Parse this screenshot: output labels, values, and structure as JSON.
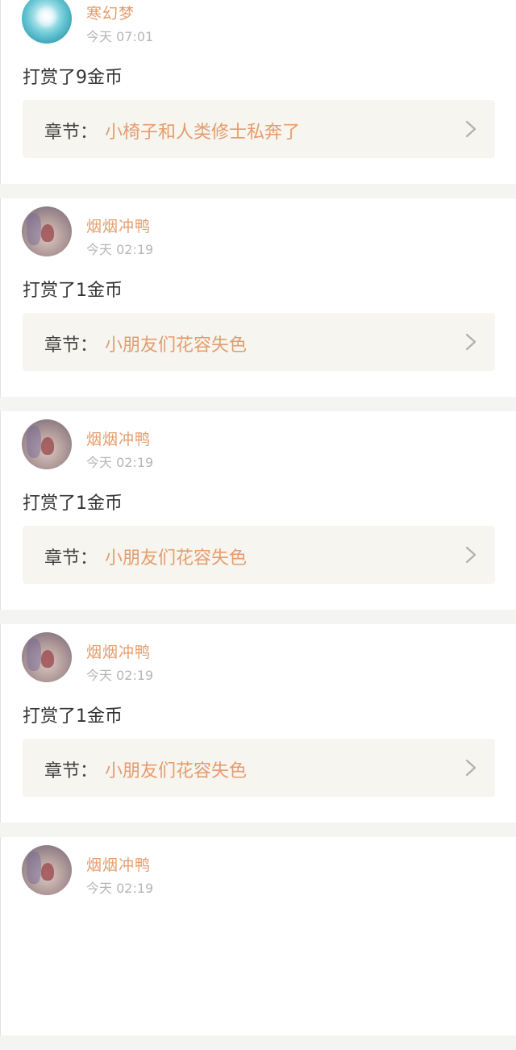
{
  "items": [
    {
      "avatar_icon": "snowflake-avatar",
      "username": "寒幻梦",
      "time": "今天 07:01",
      "reward": "打赏了9金币",
      "chapter_prefix": "章节：",
      "chapter_title": "小椅子和人类修士私奔了",
      "arrow_icon": "chevron-right-icon"
    },
    {
      "avatar_icon": "photo-avatar",
      "username": "烟烟冲鸭",
      "time": "今天 02:19",
      "reward": "打赏了1金币",
      "chapter_prefix": "章节：",
      "chapter_title": "小朋友们花容失色",
      "arrow_icon": "chevron-right-icon"
    },
    {
      "avatar_icon": "photo-avatar",
      "username": "烟烟冲鸭",
      "time": "今天 02:19",
      "reward": "打赏了1金币",
      "chapter_prefix": "章节：",
      "chapter_title": "小朋友们花容失色",
      "arrow_icon": "chevron-right-icon"
    },
    {
      "avatar_icon": "photo-avatar",
      "username": "烟烟冲鸭",
      "time": "今天 02:19",
      "reward": "打赏了1金币",
      "chapter_prefix": "章节：",
      "chapter_title": "小朋友们花容失色",
      "arrow_icon": "chevron-right-icon"
    },
    {
      "avatar_icon": "photo-avatar",
      "username": "烟烟冲鸭",
      "time": "今天 02:19",
      "reward": "",
      "chapter_prefix": "",
      "chapter_title": "",
      "arrow_icon": "chevron-right-icon"
    }
  ],
  "colors": {
    "accent": "#e59c6c",
    "text": "#333333",
    "muted": "#b6b6b6",
    "chapter_bg": "#f6f5f0",
    "page_bg": "#f4f4f2"
  }
}
